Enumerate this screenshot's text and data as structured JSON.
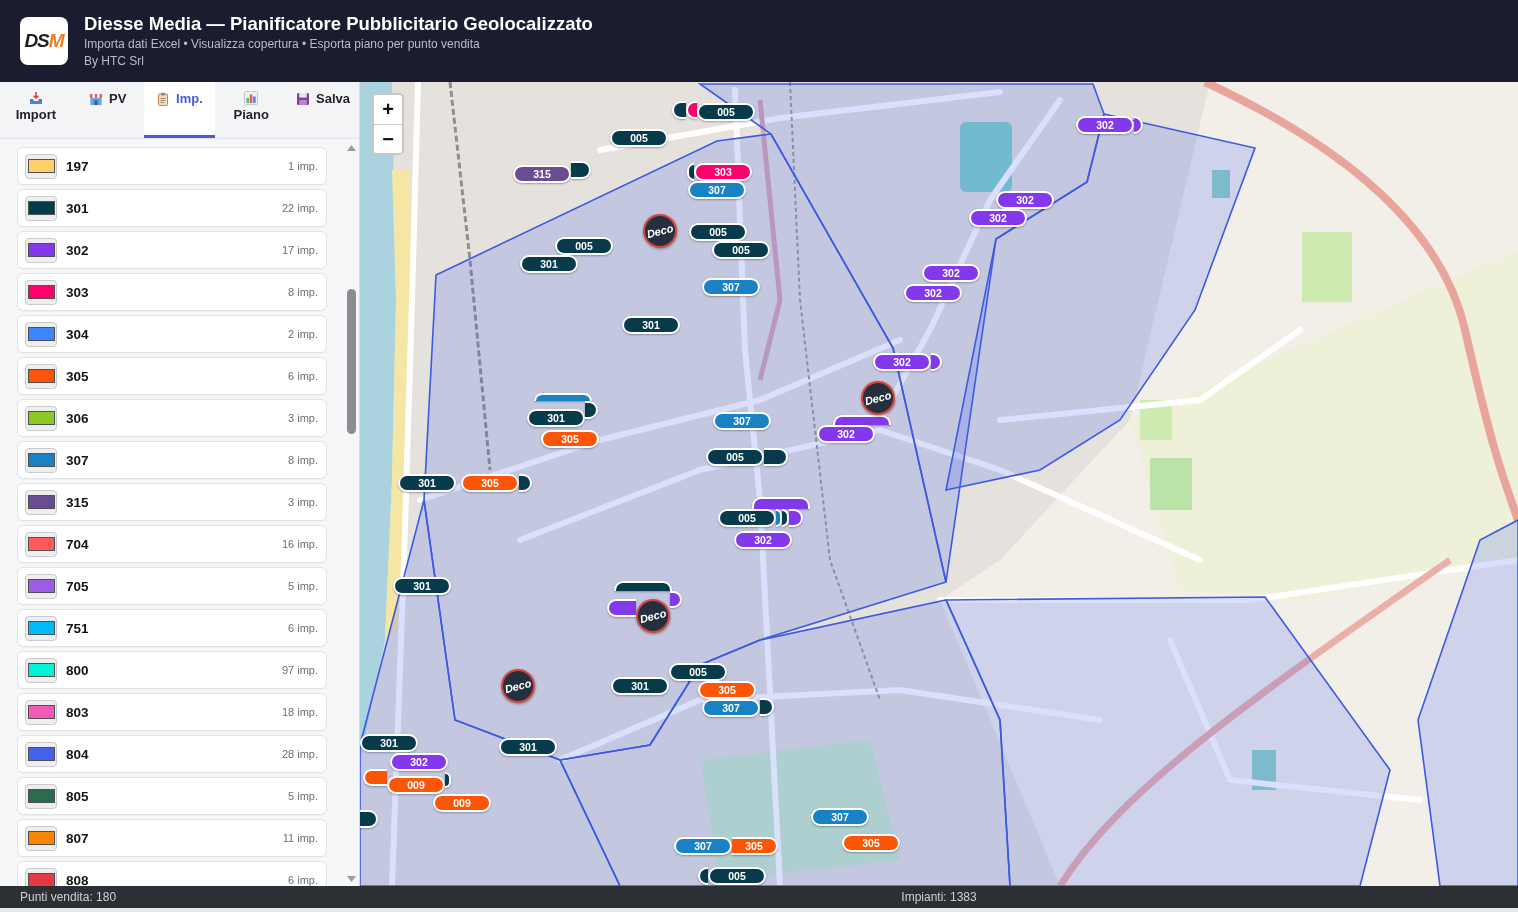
{
  "header": {
    "logo": {
      "text": "DS",
      "accent": "M"
    },
    "title": "Diesse Media — Pianificatore Pubblicitario Geolocalizzato",
    "subtitle": "Importa dati Excel • Visualizza copertura • Esporta piano per punto vendita",
    "byline": "By HTC Srl"
  },
  "tabs": [
    {
      "label": "Import",
      "selected": false
    },
    {
      "label": "PV",
      "selected": false
    },
    {
      "label": "Imp.",
      "selected": true
    },
    {
      "label": "Piano",
      "selected": false
    },
    {
      "label": "Salva",
      "selected": false
    }
  ],
  "legend": [
    {
      "code": "197",
      "count": "1 imp.",
      "color": "#ffd166"
    },
    {
      "code": "301",
      "count": "22 imp.",
      "color": "#073b4c"
    },
    {
      "code": "302",
      "count": "17 imp.",
      "color": "#8338ec"
    },
    {
      "code": "303",
      "count": "8 imp.",
      "color": "#ff006e"
    },
    {
      "code": "304",
      "count": "2 imp.",
      "color": "#3a86ff"
    },
    {
      "code": "305",
      "count": "6 imp.",
      "color": "#fb5607"
    },
    {
      "code": "306",
      "count": "3 imp.",
      "color": "#8ac926"
    },
    {
      "code": "307",
      "count": "8 imp.",
      "color": "#1982c4"
    },
    {
      "code": "315",
      "count": "3 imp.",
      "color": "#6a4c93"
    },
    {
      "code": "704",
      "count": "16 imp.",
      "color": "#ff595e"
    },
    {
      "code": "705",
      "count": "5 imp.",
      "color": "#9b5de5"
    },
    {
      "code": "751",
      "count": "6 imp.",
      "color": "#00bbf9"
    },
    {
      "code": "800",
      "count": "97 imp.",
      "color": "#00f5d4"
    },
    {
      "code": "803",
      "count": "18 imp.",
      "color": "#f15bb5"
    },
    {
      "code": "804",
      "count": "28 imp.",
      "color": "#4361ee"
    },
    {
      "code": "805",
      "count": "5 imp.",
      "color": "#2d6a4f"
    },
    {
      "code": "807",
      "count": "11 imp.",
      "color": "#fb8500"
    },
    {
      "code": "808",
      "count": "6 imp.",
      "color": "#e63946"
    }
  ],
  "map": {
    "zoom_controls": [
      {
        "label": "+"
      },
      {
        "label": "−"
      }
    ],
    "markers": [
      {
        "color": "#073b4c"
      },
      {
        "color": "#ff006e"
      },
      {
        "label": "005",
        "color": "#073b4c"
      },
      {
        "label": "302",
        "color": "#8338ec"
      },
      {
        "color": "#8338ec"
      },
      {
        "label": "005",
        "color": "#073b4c"
      },
      {
        "label": "315",
        "color": "#6a4c93"
      },
      {
        "color": "#073b4c"
      },
      {
        "color": "#073b4c"
      },
      {
        "label": "303",
        "color": "#ff006e"
      },
      {
        "label": "307",
        "color": "#1982c4"
      },
      {
        "label": "302",
        "color": "#8338ec"
      },
      {
        "label": "302",
        "color": "#8338ec"
      },
      {
        "label": "005",
        "color": "#073b4c"
      },
      {
        "label": "005",
        "color": "#073b4c"
      },
      {
        "label": "005",
        "color": "#073b4c"
      },
      {
        "label": "301",
        "color": "#073b4c"
      },
      {
        "label": "302",
        "color": "#8338ec"
      },
      {
        "label": "307",
        "color": "#1982c4"
      },
      {
        "label": "302",
        "color": "#8338ec"
      },
      {
        "label": "301",
        "color": "#073b4c"
      },
      {
        "label": "302",
        "color": "#8338ec"
      },
      {
        "color": "#8338ec"
      },
      {
        "color": "#1982c4"
      },
      {
        "label": "301",
        "color": "#073b4c"
      },
      {
        "color": "#073b4c"
      },
      {
        "label": "307",
        "color": "#1982c4"
      },
      {
        "color": "#8338ec"
      },
      {
        "label": "305",
        "color": "#fb5607"
      },
      {
        "label": "302",
        "color": "#8338ec"
      },
      {
        "label": "005",
        "color": "#073b4c"
      },
      {
        "color": "#073b4c"
      },
      {
        "label": "301",
        "color": "#073b4c"
      },
      {
        "label": "305",
        "color": "#fb5607"
      },
      {
        "color": "#073b4c"
      },
      {
        "color": "#8338ec"
      },
      {
        "label": "005",
        "color": "#073b4c"
      },
      {
        "color": "#1982c4"
      },
      {
        "color": "#073b4c"
      },
      {
        "color": "#8338ec"
      },
      {
        "label": "302",
        "color": "#8338ec"
      },
      {
        "label": "301",
        "color": "#073b4c"
      },
      {
        "color": "#073b4c"
      },
      {
        "color": "#8338ec"
      },
      {
        "color": "#8338ec"
      },
      {
        "label": "005",
        "color": "#073b4c"
      },
      {
        "label": "301",
        "color": "#073b4c"
      },
      {
        "label": "305",
        "color": "#fb5607"
      },
      {
        "label": "307",
        "color": "#1982c4"
      },
      {
        "color": "#073b4c"
      },
      {
        "label": "301",
        "color": "#073b4c"
      },
      {
        "label": "301",
        "color": "#073b4c"
      },
      {
        "label": "302",
        "color": "#8338ec"
      },
      {
        "color": "#fb5607"
      },
      {
        "label": "009",
        "color": "#fb5607"
      },
      {
        "color": "#073b4c"
      },
      {
        "label": "009",
        "color": "#fb5607"
      },
      {
        "color": "#073b4c"
      },
      {
        "label": "307",
        "color": "#1982c4"
      },
      {
        "label": "307",
        "color": "#1982c4"
      },
      {
        "label": "305",
        "color": "#fb5607"
      },
      {
        "label": "305",
        "color": "#fb5607"
      },
      {
        "color": "#073b4c"
      },
      {
        "label": "005",
        "color": "#073b4c"
      }
    ],
    "store_markers": [
      {
        "logo_text": "Deco"
      },
      {
        "logo_text": "Deco"
      },
      {
        "logo_text": "Deco"
      },
      {
        "logo_text": "Deco"
      }
    ]
  },
  "status_bar": {
    "left": "Punti vendita: 180",
    "right": "Impianti: 1383"
  }
}
